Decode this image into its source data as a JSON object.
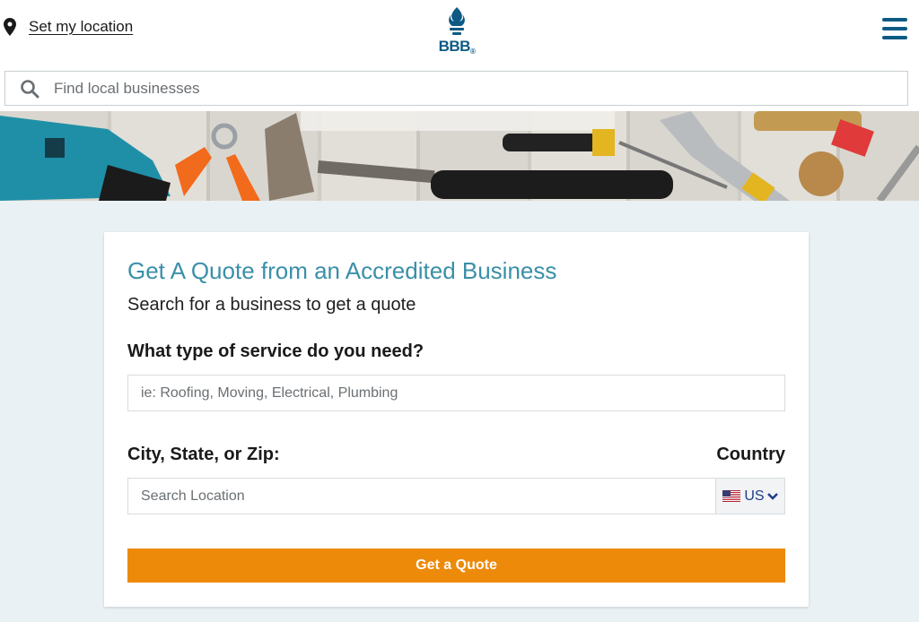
{
  "header": {
    "location_link": "Set my location",
    "logo_text": "BBB",
    "logo_mark": "®"
  },
  "search": {
    "placeholder": "Find local businesses"
  },
  "card": {
    "title": "Get A Quote from an Accredited Business",
    "subtitle": "Search for a business to get a quote",
    "service_label": "What type of service do you need?",
    "service_placeholder": "ie: Roofing, Moving, Electrical, Plumbing",
    "location_label": "City, State, or Zip:",
    "country_label": "Country",
    "location_placeholder": "Search Location",
    "country_value": "US",
    "submit_label": "Get a Quote"
  },
  "icons": {
    "location": "map-pin-icon",
    "menu": "hamburger-menu-icon",
    "search": "search-icon",
    "flag": "us-flag-icon",
    "chevron": "chevron-down-icon"
  },
  "colors": {
    "brand_blue": "#0d5a84",
    "title_teal": "#3a8fa8",
    "cta_orange": "#ed8a0a",
    "page_bg": "#eaf1f4"
  }
}
